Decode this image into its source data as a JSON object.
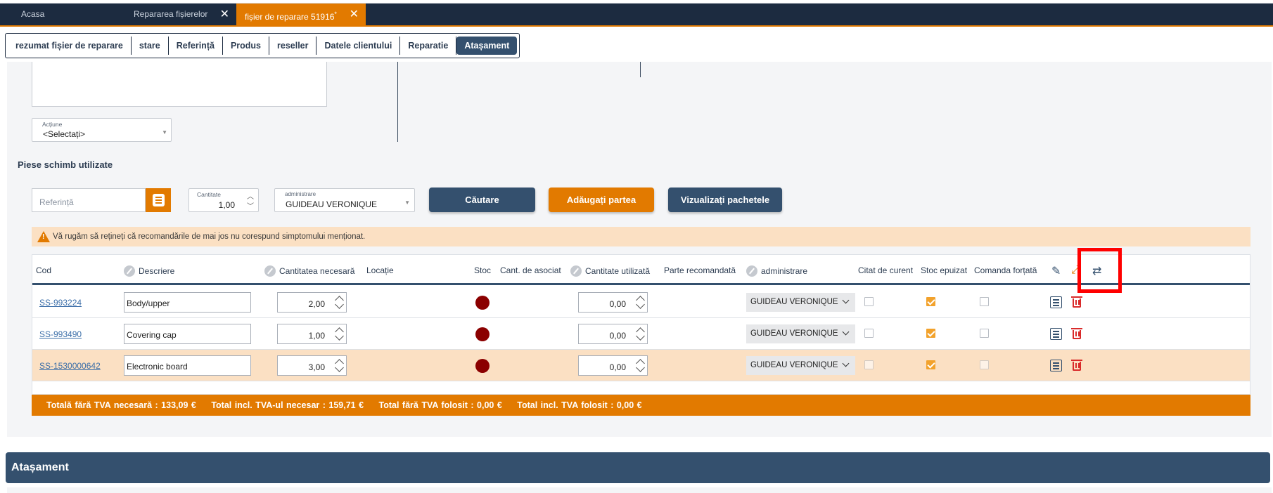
{
  "tabs": [
    {
      "label": "Acasa"
    },
    {
      "label": "Repararea fișierelor"
    },
    {
      "label": "fișier de reparare 51916",
      "modified": "*"
    }
  ],
  "nav": [
    {
      "label": "rezumat fișier de reparare"
    },
    {
      "label": "stare"
    },
    {
      "label": "Referință"
    },
    {
      "label": "Produs"
    },
    {
      "label": "reseller"
    },
    {
      "label": "Datele clientului"
    },
    {
      "label": "Reparatie"
    },
    {
      "label": "Atașament"
    }
  ],
  "action_select": {
    "label": "Acțiune",
    "value": "<Selectați>"
  },
  "parts_section_title": "Piese schimb utilizate",
  "search": {
    "reference_placeholder": "Referință",
    "quantity_label": "Cantitate",
    "quantity_value": "1,00",
    "admin_label": "administrare",
    "admin_value": "GUIDEAU VERONIQUE"
  },
  "buttons": {
    "search": "Căutare",
    "add_part": "Adăugați partea",
    "view_packages": "Vizualizați pachetele"
  },
  "warning": "Vă rugăm să rețineți că recomandările de mai jos nu corespund simptomului menționat.",
  "columns": {
    "code": "Cod",
    "description": "Descriere",
    "qty_needed": "Cantitatea necesară",
    "location": "Locație",
    "stock": "Stoc",
    "qty_assoc": "Cant. de asociat",
    "qty_used": "Cantitate utilizată",
    "recommended": "Parte recomandată",
    "admin": "administrare",
    "quoted": "Citat de curent",
    "out_of_stock": "Stoc epuizat",
    "forced_order": "Comanda forțată"
  },
  "rows": [
    {
      "code": "SS-993224",
      "description": "Body/upper",
      "qty_needed": "2,00",
      "qty_used": "0,00",
      "admin": "GUIDEAU VERONIQUE",
      "quoted": false,
      "out_of_stock": true,
      "forced": false,
      "stock_color": "#8b0000"
    },
    {
      "code": "SS-993490",
      "description": "Covering cap",
      "qty_needed": "1,00",
      "qty_used": "0,00",
      "admin": "GUIDEAU VERONIQUE",
      "quoted": false,
      "out_of_stock": true,
      "forced": false,
      "stock_color": "#8b0000"
    },
    {
      "code": "SS-1530000642",
      "description": "Electronic board",
      "qty_needed": "3,00",
      "qty_used": "0,00",
      "admin": "GUIDEAU VERONIQUE",
      "quoted": false,
      "out_of_stock": true,
      "forced": false,
      "stock_color": "#8b0000"
    }
  ],
  "totals": {
    "net_needed": "Totală fără TVA necesară : 133,09 €",
    "gross_needed": "Total incl. TVA-ul necesar : 159,71 €",
    "net_used": "Total fără TVA folosit : 0,00 €",
    "gross_used": "Total incl. TVA folosit : 0,00 €"
  },
  "attachment_section_title": "Atașament",
  "colors": {
    "accent": "#e27a00",
    "navy": "#1c2b40",
    "slate": "#34506e",
    "warning_bg": "#fbe0c3",
    "highlight": "#ff0000"
  }
}
